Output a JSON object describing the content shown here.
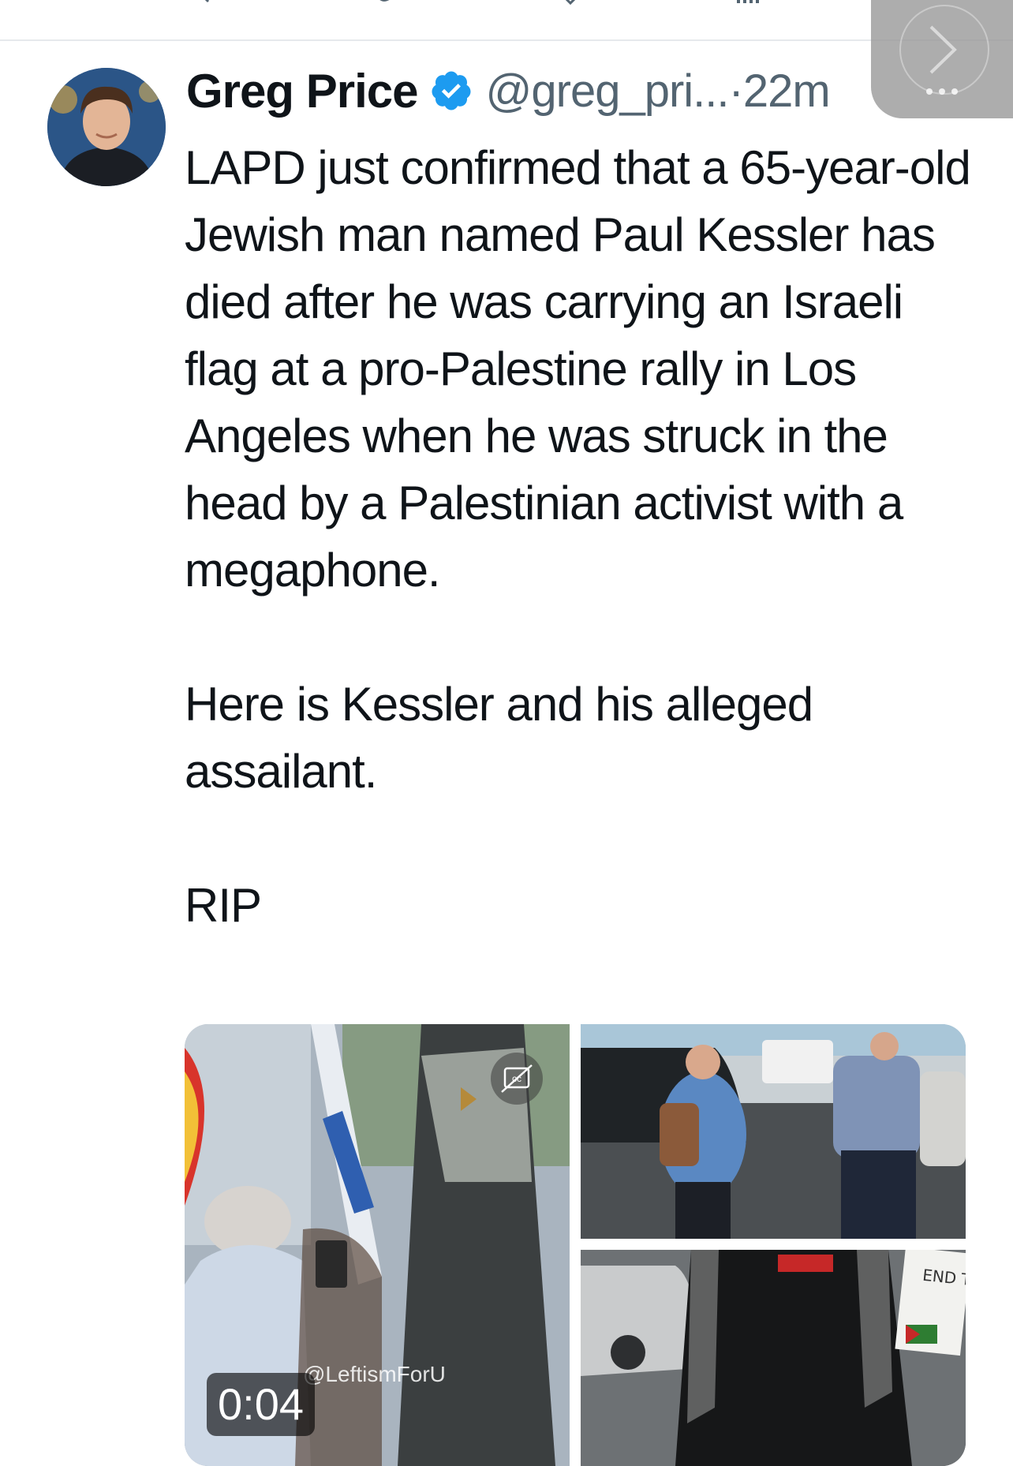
{
  "colors": {
    "verified": "#1d9bf0",
    "handle": "#536471",
    "text": "#0f1419"
  },
  "icons": {
    "top_actions": [
      "reply-icon",
      "retweet-icon",
      "like-icon",
      "views-icon",
      "share-icon"
    ],
    "verified": "verified-badge-icon",
    "next": "chevron-right-icon",
    "more": "more-icon",
    "captions": "closed-captions-icon"
  },
  "tweet": {
    "author_name": "Greg Price",
    "handle_time": "@greg_pri...·22m",
    "paragraphs": [
      "LAPD just confirmed that a 65-year-old Jewish man named Paul Kessler has died after he was carrying an Israeli flag at a pro-Palestine rally in Los Angeles when he was struck in the head by a Palestinian activist with a megaphone.",
      "Here is Kessler and his alleged assailant.",
      "RIP"
    ]
  },
  "media": {
    "watermark": "@LeftismForU",
    "duration": "0:04",
    "sign_text": "END THE ISRAELI"
  }
}
